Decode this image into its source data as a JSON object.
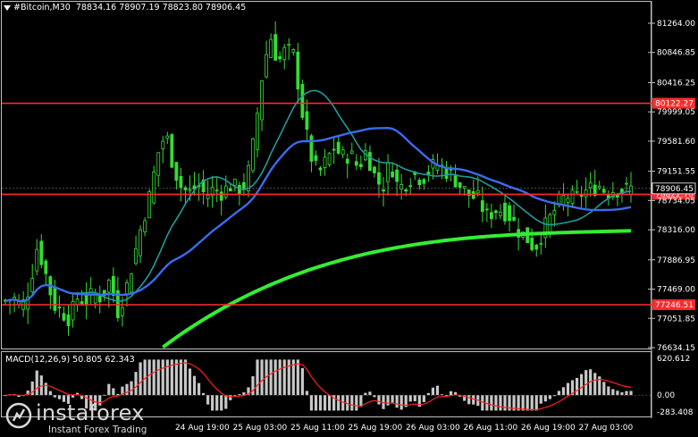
{
  "header": {
    "symbol": "#Bitcoin,M30",
    "ohlc": "78834.16 78907.19 78823.80 78906.45"
  },
  "price_axis": {
    "labels": [
      "81264.00",
      "80846.85",
      "80416.25",
      "79999.05",
      "79581.60",
      "79151.55",
      "78734.05",
      "78316.00",
      "77886.95",
      "77469.00",
      "77051.85",
      "76634.15"
    ],
    "values": [
      81264.0,
      80846.85,
      80416.25,
      79999.05,
      79581.6,
      79151.55,
      78734.05,
      78316.0,
      77886.95,
      77469.0,
      77051.85,
      76634.15
    ]
  },
  "price_markers": [
    {
      "label": "80122.27",
      "value": 80122.27,
      "color": "#ff2a2a",
      "kind": "level"
    },
    {
      "label": "78822.70",
      "value": 78822.7,
      "color": "#ff2a2a",
      "kind": "level"
    },
    {
      "label": "77246.51",
      "value": 77246.51,
      "color": "#ff2a2a",
      "kind": "level"
    },
    {
      "label": "78906.45",
      "value": 78906.45,
      "color": "#ffffff",
      "kind": "bid"
    }
  ],
  "time_axis": {
    "labels": [
      "24 Aug 19:00",
      "25 Aug 03:00",
      "25 Aug 11:00",
      "25 Aug 19:00",
      "26 Aug 03:00",
      "26 Aug 11:00",
      "26 Aug 19:00",
      "27 Aug 03:00"
    ]
  },
  "macd": {
    "label": "MACD(12,26,9) 50.805 62.343",
    "axis_labels": [
      "620.612",
      "0.00",
      "-283.408"
    ],
    "axis_values": [
      620.612,
      0,
      -283.408
    ]
  },
  "watermark": {
    "name": "instaforex",
    "tagline": "Instant Forex Trading"
  },
  "colors": {
    "background": "#000000",
    "candles": "#33dd33",
    "ma_blue": "#3a6cf0",
    "ma_teal": "#1e9c9c",
    "ma_green": "#33ee33",
    "level_lines": "#ff2a2a",
    "macd_hist": "#c8c8c8",
    "macd_signal": "#ff2020"
  },
  "chart_data": {
    "type": "line",
    "series": [
      {
        "name": "#Bitcoin,M30",
        "values": [
          77300,
          77350,
          77200,
          77500,
          78100,
          77700,
          77250,
          77150,
          77050,
          77350,
          77300,
          77400,
          77350,
          77600,
          77150,
          77450,
          77900,
          78400,
          78800,
          79400,
          79700,
          79200,
          78900,
          78850,
          78950,
          78800,
          78900,
          78850,
          78950,
          78900,
          78950,
          79600,
          80500,
          81100,
          80700,
          80900,
          80800,
          80000,
          79400,
          79100,
          79300,
          79500,
          79350,
          79400,
          79200,
          79450,
          79100,
          78900,
          79300,
          78900,
          79000,
          79100,
          79050,
          79200,
          79250,
          79150,
          79050,
          78900,
          78800,
          78750,
          78500,
          78600,
          78600,
          78500,
          78300,
          78200,
          78050,
          78300,
          78500,
          78700,
          78800,
          78750,
          78850,
          78900,
          78950,
          78850,
          78900,
          78880,
          78906
        ]
      }
    ]
  }
}
